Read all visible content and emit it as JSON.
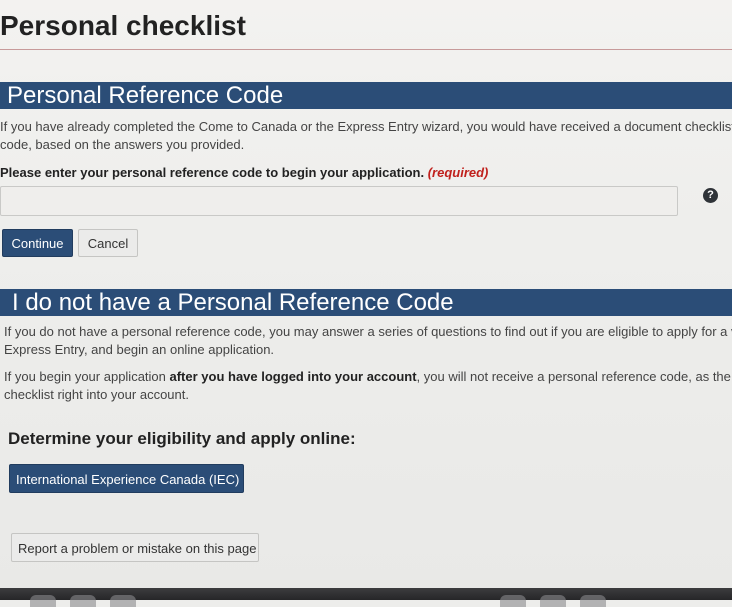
{
  "page": {
    "title": "Personal checklist"
  },
  "reference_section": {
    "heading": "Personal Reference Code",
    "description_line1": "If you have already completed the Come to Canada or the Express Entry wizard, you would have received a document checklist",
    "description_line2": "code, based on the answers you provided.",
    "field_label": "Please enter your personal reference code to begin your application.",
    "required_text": "(required)",
    "input_value": "",
    "help_icon_glyph": "?",
    "continue_label": "Continue",
    "cancel_label": "Cancel"
  },
  "no_code_section": {
    "heading": "I do not have a Personal Reference Code",
    "para1_line1": "If you do not have a personal reference code, you may answer a series of questions to find out if you are eligible to apply for a vis",
    "para1_line2": "Express Entry, and begin an online application.",
    "para2_prefix": "If you begin your application ",
    "para2_bold": "after you have logged into your account",
    "para2_suffix": ", you will not receive a personal reference code, as the sy",
    "para2_line2": "checklist right into your account.",
    "eligibility_heading": "Determine your eligibility and apply online:",
    "iec_button_label": "International Experience Canada (IEC)"
  },
  "footer": {
    "report_button_label": "Report a problem or mistake on this page"
  },
  "colors": {
    "header_bar": "#2b4d77",
    "required": "#c0201c",
    "page_background": "#eeeeec"
  },
  "icons": {
    "help": "help-icon"
  }
}
